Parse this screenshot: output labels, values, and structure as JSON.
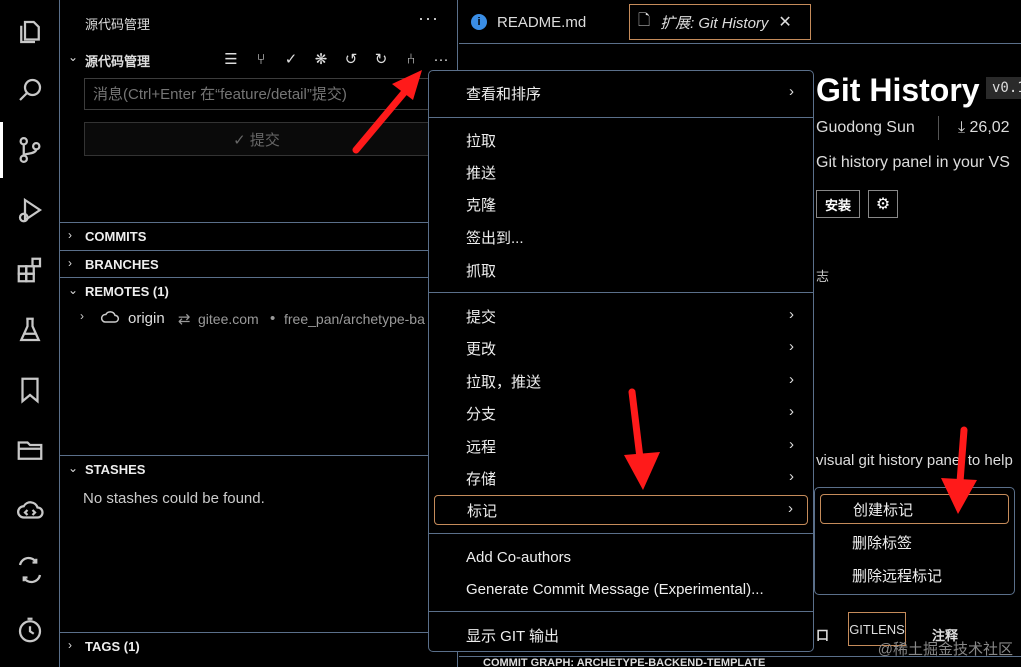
{
  "activity_bar": {
    "items": [
      {
        "name": "explorer-icon"
      },
      {
        "name": "search-icon"
      },
      {
        "name": "source-control-icon"
      },
      {
        "name": "run-debug-icon"
      },
      {
        "name": "extensions-icon"
      },
      {
        "name": "testing-icon"
      },
      {
        "name": "bookmarks-icon"
      },
      {
        "name": "project-manager-icon"
      },
      {
        "name": "remote-explorer-icon"
      },
      {
        "name": "diff-icon"
      },
      {
        "name": "timeline-icon"
      }
    ],
    "active": "source-control-icon"
  },
  "sidebar": {
    "title": "源代码管理",
    "more": "···",
    "scm_header": "源代码管理",
    "commit_message_placeholder": "消息(Ctrl+Enter 在“feature/detail”提交)",
    "commit_button": "✓ 提交",
    "sections": {
      "commits": "COMMITS",
      "branches": "BRANCHES",
      "remotes": "REMOTES (1)",
      "stashes": "STASHES",
      "tags": "TAGS (1)"
    },
    "remote": {
      "name": "origin",
      "arrow": "⇄",
      "host": "gitee.com",
      "separator": "•",
      "path": "free_pan/archetype-ba"
    },
    "stashes_empty": "No stashes could be found."
  },
  "tabs": [
    {
      "label": "README.md"
    },
    {
      "label": "扩展: Git History"
    }
  ],
  "extension": {
    "title": "Git History",
    "version": "v0.1",
    "author": "Guodong Sun",
    "downloads": "26,02",
    "description": "Git history panel in your VS",
    "install": "安装",
    "log_fragment": "志",
    "body": "visual git history panel to help"
  },
  "context_menu": {
    "items": [
      {
        "label": "查看和排序",
        "submenu": true
      },
      {
        "label": "拉取"
      },
      {
        "label": "推送"
      },
      {
        "label": "克隆"
      },
      {
        "label": "签出到..."
      },
      {
        "label": "抓取"
      },
      {
        "label": "提交",
        "submenu": true
      },
      {
        "label": "更改",
        "submenu": true
      },
      {
        "label": "拉取，推送",
        "submenu": true
      },
      {
        "label": "分支",
        "submenu": true
      },
      {
        "label": "远程",
        "submenu": true
      },
      {
        "label": "存储",
        "submenu": true
      },
      {
        "label": "标记",
        "submenu": true,
        "highlighted": true
      },
      {
        "label": "Add Co-authors"
      },
      {
        "label": "Generate Commit Message (Experimental)..."
      },
      {
        "label": "显示 GIT 输出"
      }
    ],
    "submenu_arrow": "›"
  },
  "tag_submenu": {
    "items": [
      {
        "label": "创建标记",
        "highlighted": true
      },
      {
        "label": "删除标签"
      },
      {
        "label": "删除远程标记"
      }
    ]
  },
  "panel": {
    "tab_fragment": "口",
    "gitlens": "GITLENS",
    "notes": "注释",
    "commit_graph": "COMMIT GRAPH: ARCHETYPE-BACKEND-TEMPLATE"
  },
  "watermark": "@稀土掘金技术社区",
  "colors": {
    "background": "#000000",
    "border": "#5a6f8a",
    "highlight": "#c58b5a",
    "annotation_arrow": "#ff1a1a"
  }
}
